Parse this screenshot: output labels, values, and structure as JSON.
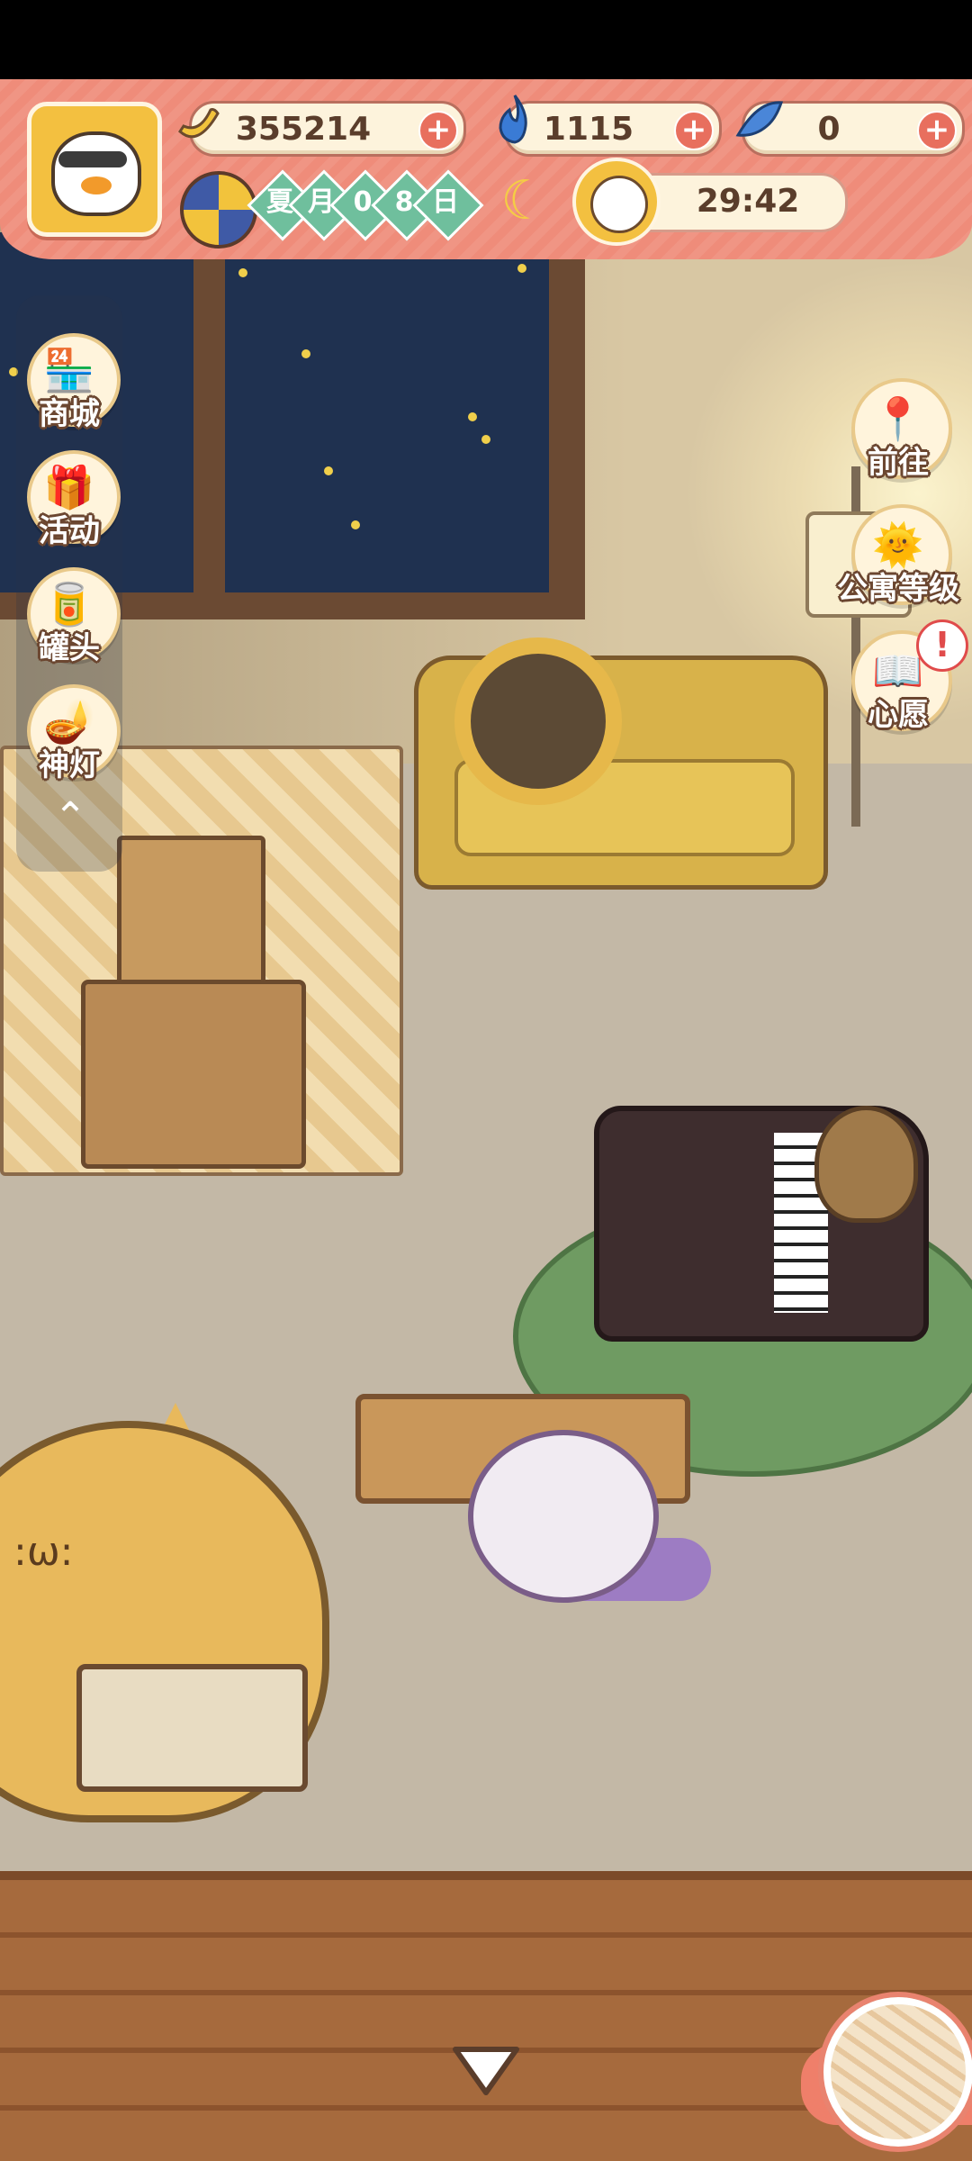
{
  "currencies": {
    "banana": {
      "value": "355214",
      "icon": "banana-icon"
    },
    "flame": {
      "value": "1115",
      "icon": "blue-flame-icon"
    },
    "fish": {
      "value": "0",
      "icon": "fish-icon"
    }
  },
  "calendar": {
    "season": "夏",
    "month_label": "月",
    "day_digit_1": "0",
    "day_digit_2": "8",
    "day_label": "日"
  },
  "timer": {
    "value": "29:42"
  },
  "left_menu": {
    "shop": "商城",
    "events": "活动",
    "cans": "罐头",
    "genie_lamp": "神灯"
  },
  "right_menu": {
    "go_to": "前往",
    "apartment_level": "公寓等级",
    "wish": "心愿",
    "alert": "!"
  },
  "colors": {
    "hud": "#ef8c7a",
    "accent_plus": "#e86f5e",
    "date_badge": "#6fbf9d",
    "text_dark": "#5a3d2b"
  }
}
